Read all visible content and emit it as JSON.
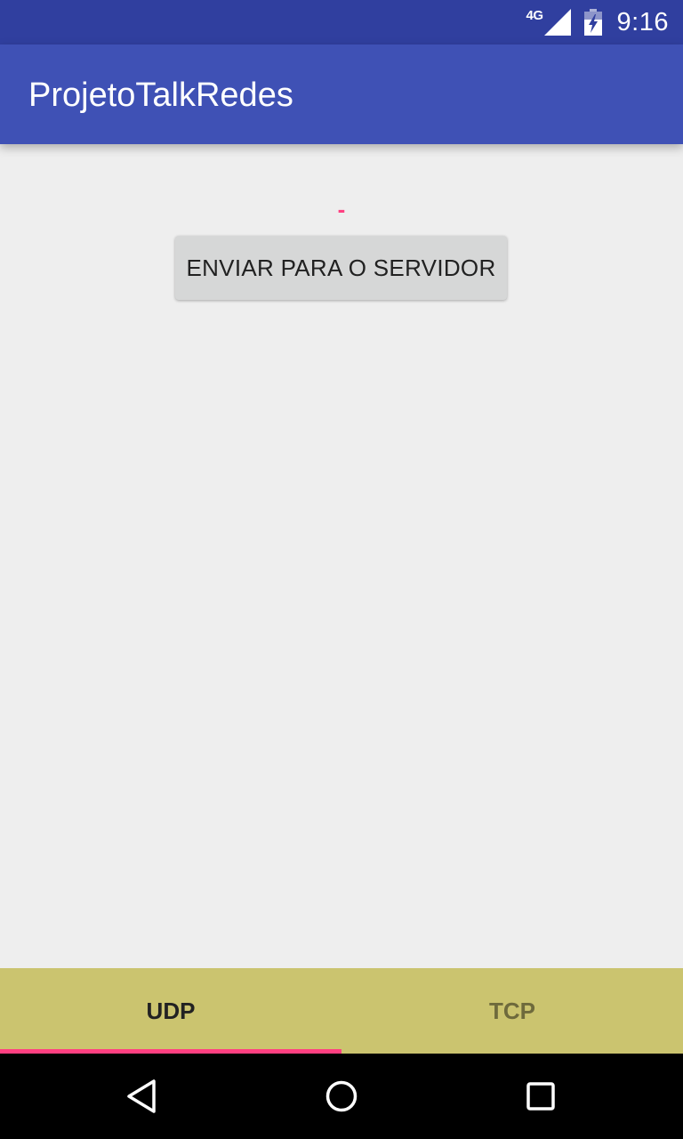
{
  "status_bar": {
    "network": "4G",
    "time": "9:16",
    "icons": [
      "signal-icon",
      "battery-icon"
    ]
  },
  "app_bar": {
    "title": "ProjetoTalkRedes"
  },
  "content": {
    "result_text": "-",
    "send_button_label": "ENVIAR PARA O SERVIDOR"
  },
  "tabs": [
    {
      "label": "UDP",
      "selected": true
    },
    {
      "label": "TCP",
      "selected": false
    }
  ],
  "nav_bar": {
    "icons": [
      "back-icon",
      "home-icon",
      "recents-icon"
    ]
  },
  "colors": {
    "status_bar": "#303f9f",
    "primary": "#3f51b5",
    "accent": "#ff4081",
    "background": "#eeeeee",
    "tab_bar": "#cbc46f",
    "button": "#d6d7d7"
  }
}
